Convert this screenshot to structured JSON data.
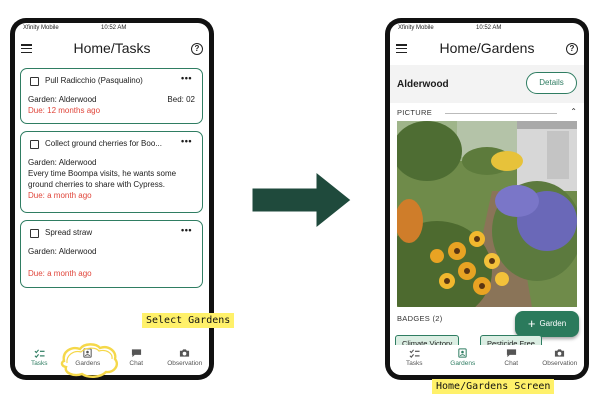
{
  "left_screen": {
    "status": {
      "carrier": "Xfinity Mobile",
      "time": "10:52 AM"
    },
    "title": "Home/Tasks",
    "tasks": [
      {
        "title": "Pull Radicchio (Pasqualino)",
        "garden": "Garden: Alderwood",
        "bed": "Bed: 02",
        "note": "",
        "due": "Due: 12 months ago"
      },
      {
        "title": "Collect ground cherries for Boo...",
        "garden": "Garden: Alderwood",
        "bed": "",
        "note": "Every time Boompa visits, he wants some ground cherries to share with Cypress.",
        "due": "Due: a month ago"
      },
      {
        "title": "Spread straw",
        "garden": "Garden: Alderwood",
        "bed": "",
        "note": "",
        "due": "Due: a month ago"
      }
    ],
    "nav": [
      "Tasks",
      "Gardens",
      "Chat",
      "Observation"
    ]
  },
  "right_screen": {
    "status": {
      "carrier": "Xfinity Mobile",
      "time": "10:52 AM"
    },
    "title": "Home/Gardens",
    "garden_name": "Alderwood",
    "details_label": "Details",
    "picture_label": "PICTURE",
    "badges_label": "BADGES",
    "badges_count": "(2)",
    "badges": [
      "Climate Victory",
      "Pesticide Free"
    ],
    "fab_label": "Garden",
    "nav": [
      "Tasks",
      "Gardens",
      "Chat",
      "Observation"
    ]
  },
  "annotations": {
    "select_label": "Select Gardens",
    "screen_label": "Home/Gardens Screen"
  },
  "colors": {
    "accent": "#2f7d62",
    "due_text": "#e0453a",
    "highlight": "#fff16a",
    "arrow": "#1f4a3c",
    "scribble": "#f5d84a"
  },
  "icons": {
    "menu": "menu-icon",
    "help": "help-icon",
    "more": "more-icon",
    "tasks_nav": "tasks-icon",
    "gardens_nav": "gardens-icon",
    "chat_nav": "chat-icon",
    "observation_nav": "camera-icon",
    "fab": "plus-icon",
    "collapse": "chevron-up-icon"
  }
}
